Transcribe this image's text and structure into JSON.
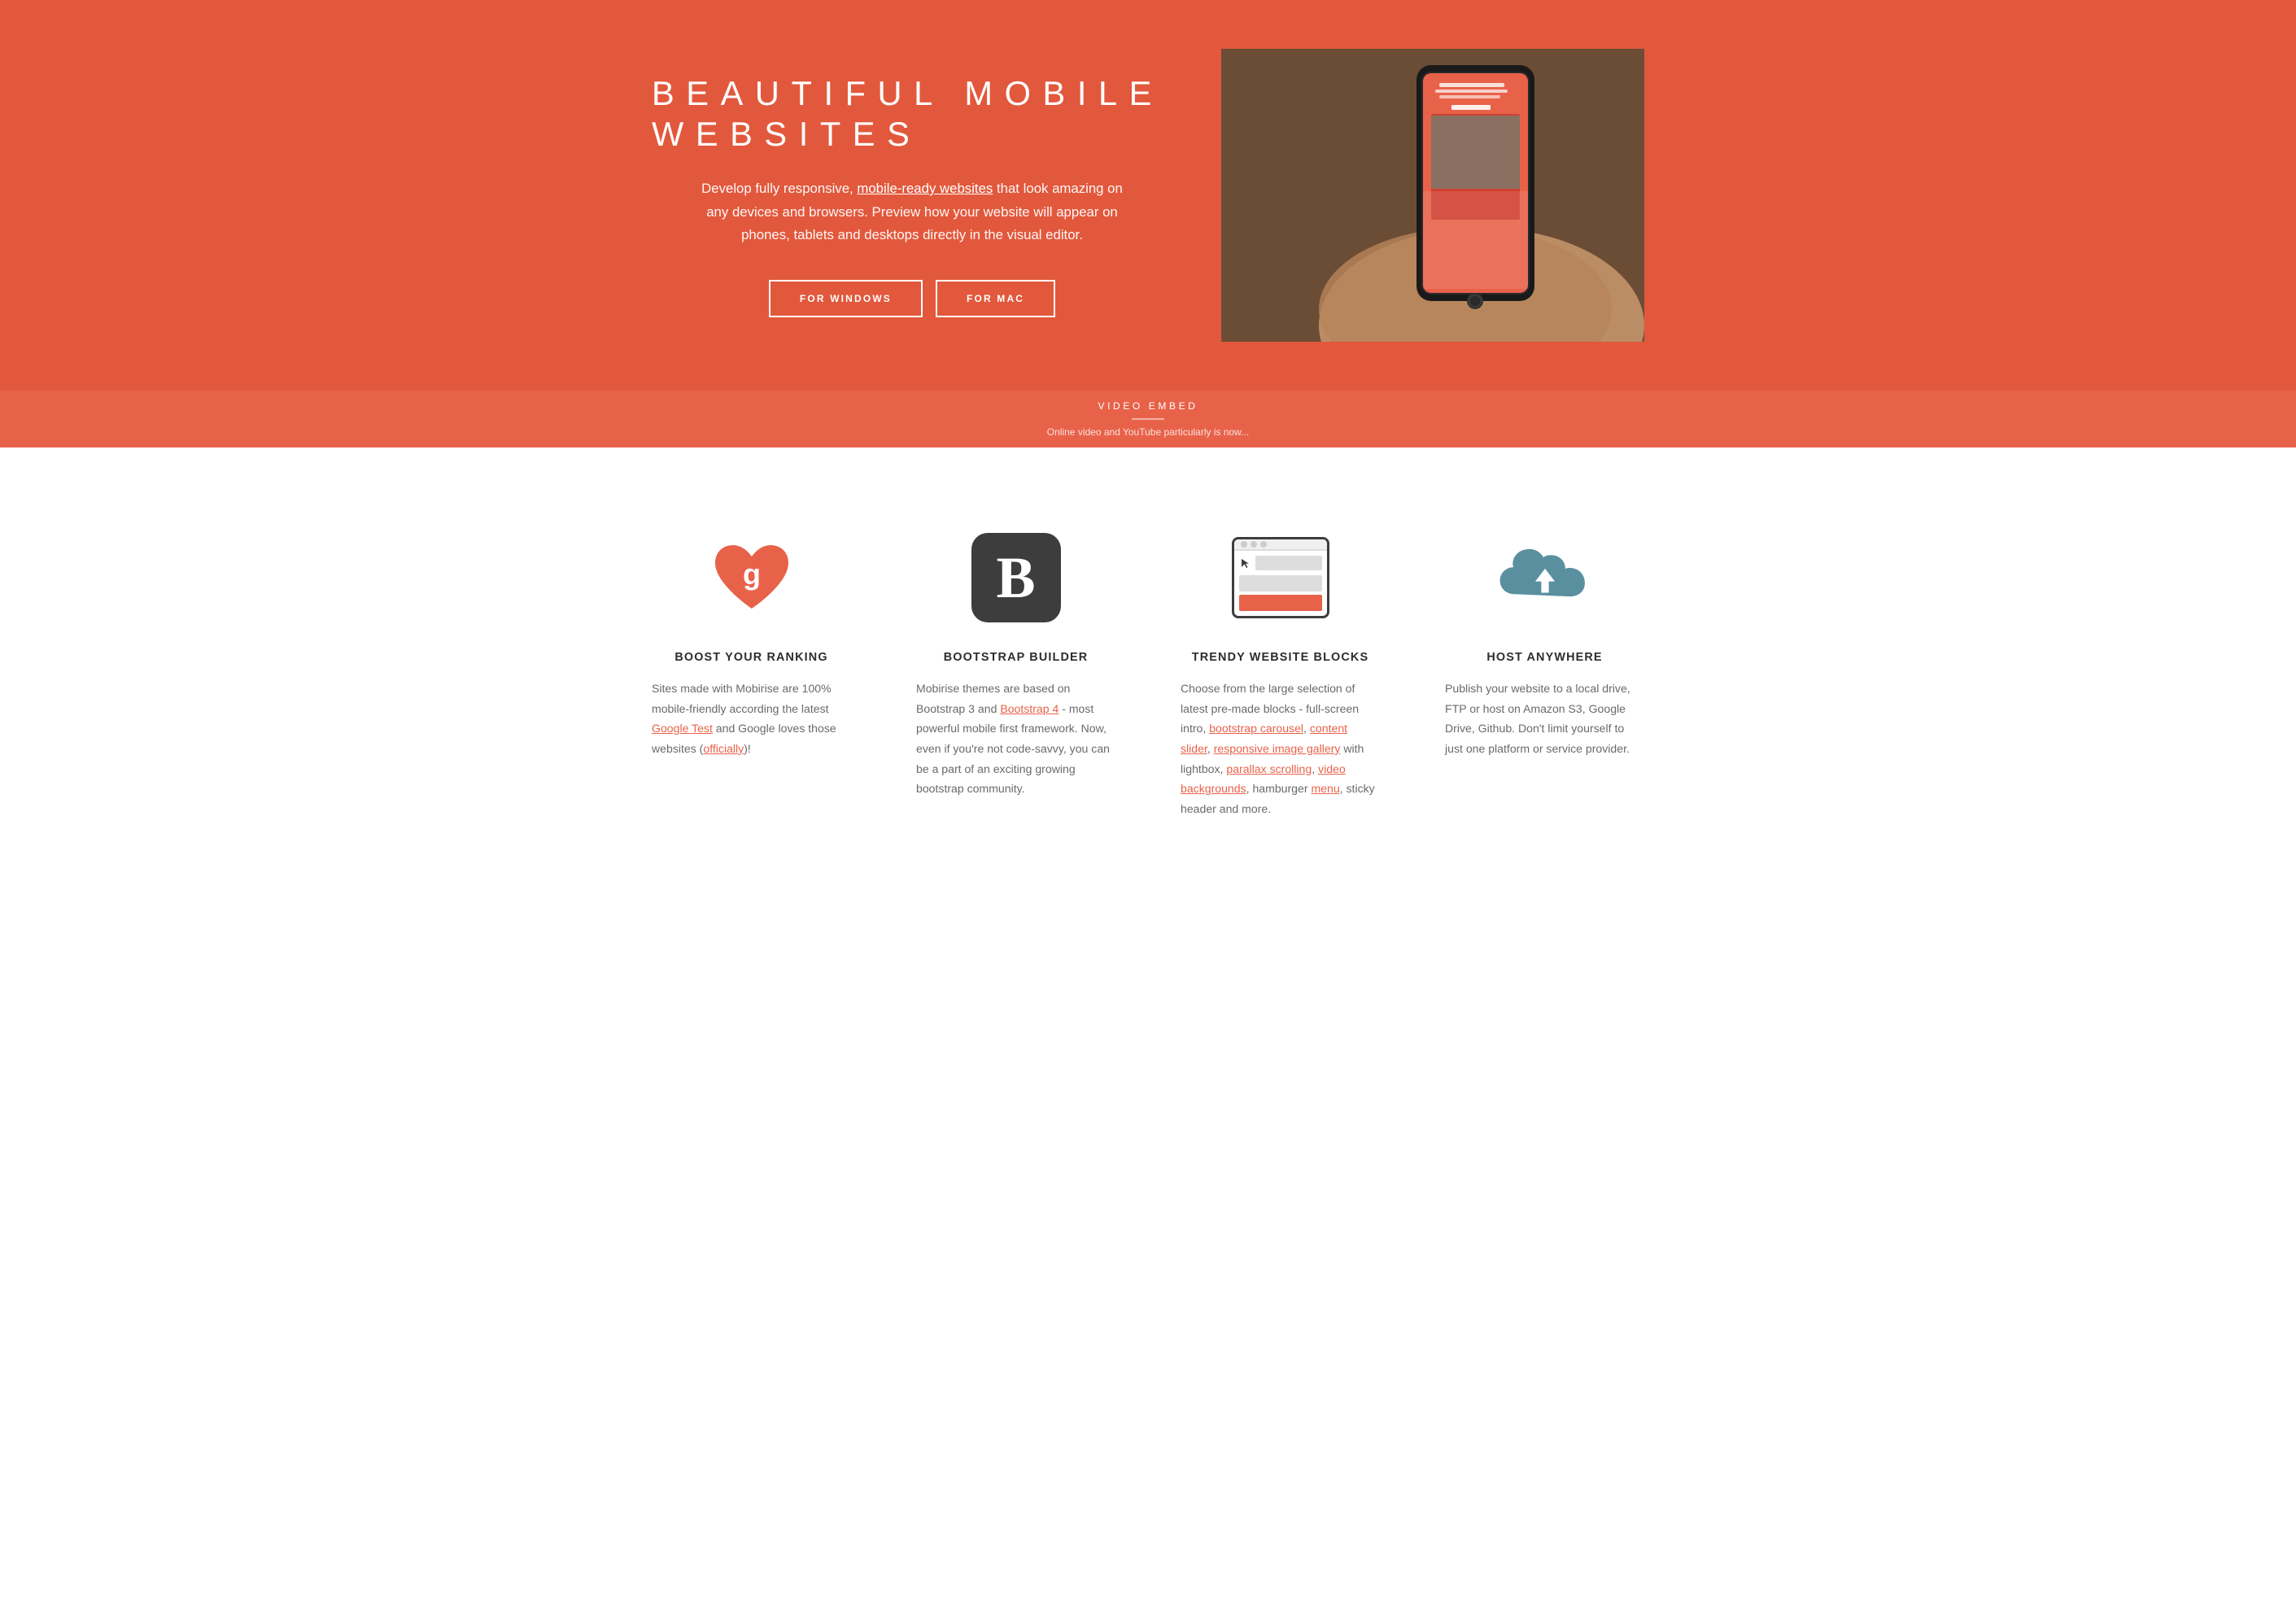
{
  "hero": {
    "title": "BEAUTIFUL MOBILE WEBSITES",
    "description": "Develop fully responsive, mobile-ready websites that look amazing on any devices and browsers. Preview how your website will appear on phones, tablets and desktops directly in the visual editor.",
    "description_link": "mobile-ready websites",
    "btn_windows": "FOR WINDOWS",
    "btn_mac": "FOR MAC",
    "phone_screen": {
      "title": "MOBIRISE WEBSITE BUILDER",
      "subtitle": "Create awesome no-code websites. No coding and no..."
    }
  },
  "video_strip": {
    "title": "VIDEO EMBED",
    "desc": "Online video and YouTube particularly is now..."
  },
  "features": [
    {
      "id": "boost",
      "icon": "heart-google",
      "title": "BOOST YOUR RANKING",
      "desc_parts": [
        {
          "text": "Sites made with Mobirise are 100% mobile-friendly according the latest "
        },
        {
          "text": "Google Test",
          "link": true
        },
        {
          "text": " and Google loves those websites ("
        },
        {
          "text": "officially",
          "link": true
        },
        {
          "text": ")!"
        }
      ]
    },
    {
      "id": "bootstrap",
      "icon": "bootstrap-b",
      "title": "BOOTSTRAP BUILDER",
      "desc_parts": [
        {
          "text": "Mobirise themes are based on Bootstrap 3 and "
        },
        {
          "text": "Bootstrap 4",
          "link": true
        },
        {
          "text": " - most powerful mobile first framework. Now, even if you're not code-savvy, you can be a part of an exciting growing bootstrap community."
        }
      ]
    },
    {
      "id": "trendy",
      "icon": "browser-blocks",
      "title": "TRENDY WEBSITE BLOCKS",
      "desc_parts": [
        {
          "text": "Choose from the large selection of latest pre-made blocks - full-screen intro, "
        },
        {
          "text": "bootstrap carousel",
          "link": true
        },
        {
          "text": ", "
        },
        {
          "text": "content slider",
          "link": true
        },
        {
          "text": ", "
        },
        {
          "text": "responsive image gallery",
          "link": true
        },
        {
          "text": " with lightbox, "
        },
        {
          "text": "parallax scrolling",
          "link": true
        },
        {
          "text": ", "
        },
        {
          "text": "video backgrounds",
          "link": true
        },
        {
          "text": ", hamburger "
        },
        {
          "text": "menu",
          "link": true
        },
        {
          "text": ", sticky header and more."
        }
      ]
    },
    {
      "id": "host",
      "icon": "cloud-upload",
      "title": "HOST ANYWHERE",
      "desc_parts": [
        {
          "text": "Publish your website to a local drive, FTP or host on Amazon S3, Google Drive, Github. Don't limit yourself to just one platform or service provider."
        }
      ]
    }
  ],
  "colors": {
    "primary": "#e8624a",
    "dark": "#3d3d3d",
    "text": "#6a6a6a",
    "heading": "#2d2d2d"
  }
}
